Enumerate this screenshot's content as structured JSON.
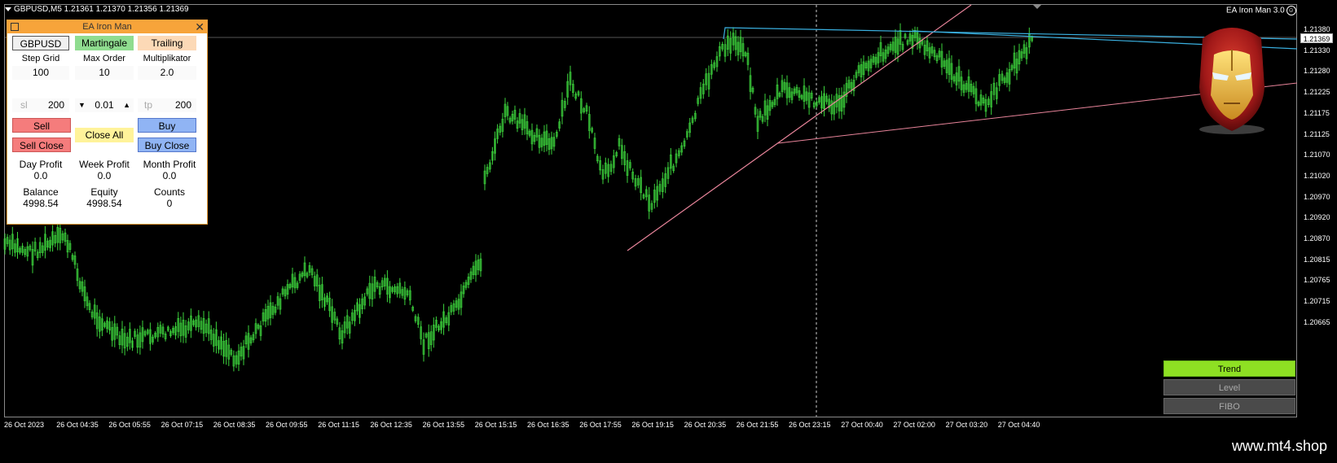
{
  "chart": {
    "header": "GBPUSD,M5  1.21361 1.21370 1.21356 1.21369",
    "ea_label": "EA Iron Man 3.0",
    "current_price": "1.21369",
    "price_axis": [
      "1.21380",
      "1.21330",
      "1.21280",
      "1.21225",
      "1.21175",
      "1.21125",
      "1.21070",
      "1.21020",
      "1.20970",
      "1.20920",
      "1.20870",
      "1.20815",
      "1.20765",
      "1.20715",
      "1.20665"
    ],
    "time_axis": [
      "26 Oct 2023",
      "26 Oct 04:35",
      "26 Oct 05:55",
      "26 Oct 07:15",
      "26 Oct 08:35",
      "26 Oct 09:55",
      "26 Oct 11:15",
      "26 Oct 12:35",
      "26 Oct 13:55",
      "26 Oct 15:15",
      "26 Oct 16:35",
      "26 Oct 17:55",
      "26 Oct 19:15",
      "26 Oct 20:35",
      "26 Oct 21:55",
      "26 Oct 23:15",
      "27 Oct 00:40",
      "27 Oct 02:00",
      "27 Oct 03:20",
      "27 Oct 04:40"
    ],
    "colors": {
      "candle": "#3cd43c",
      "trend": "#e8849a",
      "level": "#3ab0e0",
      "axis": "#8a8a8a"
    }
  },
  "panel": {
    "title": "EA Iron Man",
    "symbol_button": "GBPUSD",
    "martingale_button": "Martingale",
    "trailing_button": "Trailing",
    "labels": {
      "step_grid": "Step Grid",
      "max_order": "Max Order",
      "multiplikator": "Multiplikator"
    },
    "values": {
      "step_grid": "100",
      "max_order": "10",
      "multiplikator": "2.0"
    },
    "sl_label": "sl",
    "sl_value": "200",
    "lot_value": "0.01",
    "tp_label": "tp",
    "tp_value": "200",
    "sell_button": "Sell",
    "buy_button": "Buy",
    "close_all_button": "Close All",
    "sell_close_button": "Sell Close",
    "buy_close_button": "Buy Close",
    "stats": {
      "day_profit_label": "Day Profit",
      "day_profit": "0.0",
      "week_profit_label": "Week Profit",
      "week_profit": "0.0",
      "month_profit_label": "Month Profit",
      "month_profit": "0.0",
      "balance_label": "Balance",
      "balance": "4998.54",
      "equity_label": "Equity",
      "equity": "4998.54",
      "counts_label": "Counts",
      "counts": "0"
    }
  },
  "tools": {
    "trend": "Trend",
    "level": "Level",
    "fibo": "FIBO"
  },
  "watermark": "www.mt4.shop"
}
